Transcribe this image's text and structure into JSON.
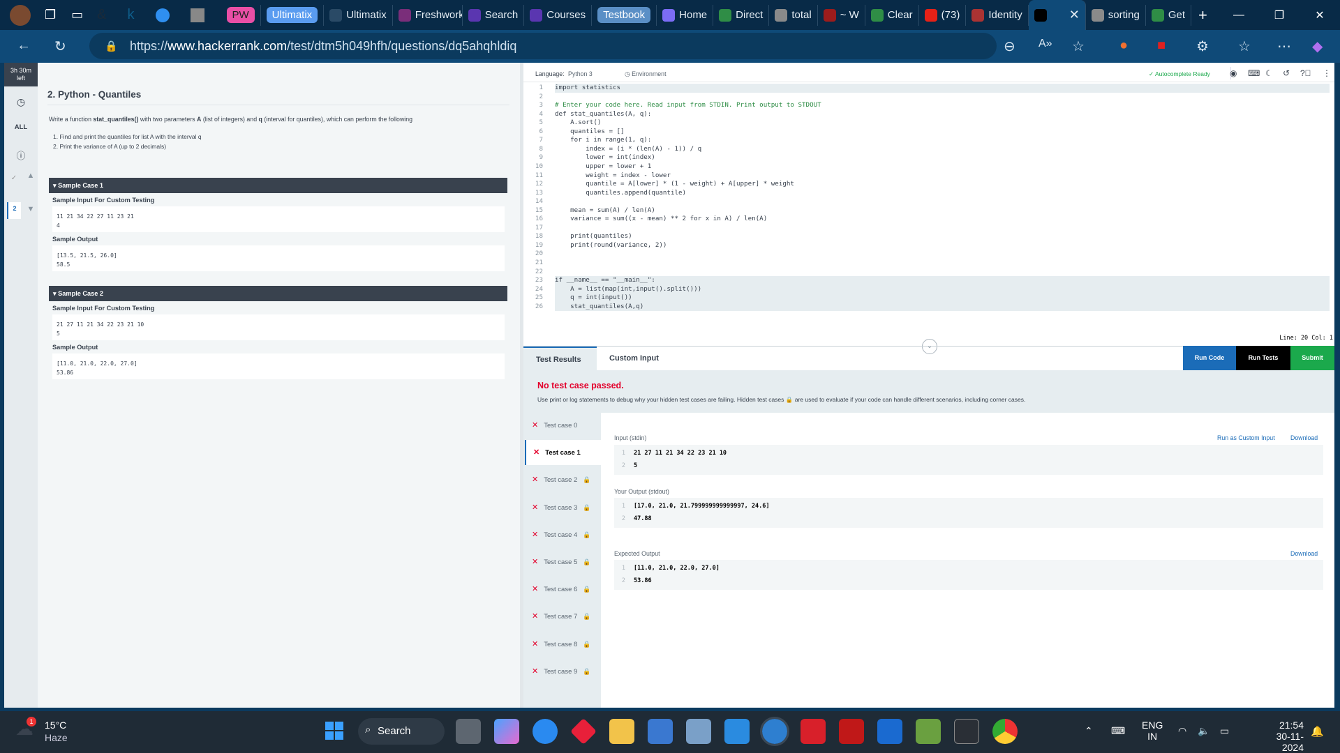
{
  "browser": {
    "tabs": [
      {
        "label": "PW",
        "color": "#e94fa6",
        "style": "pill"
      },
      {
        "label": "Ultimatix",
        "color": "#5a9cf0",
        "style": "pill"
      },
      {
        "label": "Ultimatix",
        "color": "#2a4a66"
      },
      {
        "label": "Freshworks",
        "color": "#7a2e7a"
      },
      {
        "label": "Search",
        "color": "#5a36b0"
      },
      {
        "label": "Courses",
        "color": "#5a36b0"
      },
      {
        "label": "Testbook",
        "color": "#5a8fc6",
        "style": "pill"
      },
      {
        "label": "Home",
        "color": "#7b6cf5"
      },
      {
        "label": "Direct",
        "color": "#2f8d46"
      },
      {
        "label": "total",
        "color": "#8a8a8a"
      },
      {
        "label": "~ W",
        "color": "#9b1c1c"
      },
      {
        "label": "Clear",
        "color": "#2f8d46"
      },
      {
        "label": "(73)",
        "color": "#e62117"
      },
      {
        "label": "Identity",
        "color": "#a33"
      },
      {
        "label": "",
        "color": "#000",
        "active": true
      },
      {
        "label": "sorting",
        "color": "#8a8a8a"
      },
      {
        "label": "Get",
        "color": "#2f8d46"
      }
    ],
    "url_prefix": "https://",
    "url_host": "www.hackerrank.com",
    "url_path": "/test/dtm5h049hfh/questions/dq5ahqhldiq"
  },
  "rail": {
    "timer_line1": "3h 30m",
    "timer_line2": "left",
    "all_label": "ALL",
    "current_question": "2"
  },
  "question": {
    "title": "2. Python - Quantiles",
    "desc_pre": "Write a function ",
    "desc_fn": "stat_quantiles()",
    "desc_mid1": " with two parameters ",
    "desc_A": "A",
    "desc_mid2": " (list of integers) and ",
    "desc_q": "q",
    "desc_post": " (interval for quantiles), which can perform the following",
    "steps": [
      "1. Find and print the quantiles for list A with the interval q",
      "2. Print the variance of A (up to 2 decimals)"
    ],
    "samples": [
      {
        "title": "Sample Case 1",
        "input_label": "Sample Input For Custom Testing",
        "input": "11 21 34 22 27 11 23 21\n4",
        "output_label": "Sample Output",
        "output": "[13.5, 21.5, 26.0]\n58.5"
      },
      {
        "title": "Sample Case 2",
        "input_label": "Sample Input For Custom Testing",
        "input": "21 27 11 21 34 22 23 21 10\n5",
        "output_label": "Sample Output",
        "output": "[11.0, 21.0, 22.0, 27.0]\n53.86"
      }
    ]
  },
  "editor": {
    "language_label": "Language:",
    "language": "Python 3",
    "environment": "Environment",
    "autocomplete": "Autocomplete Ready",
    "status": "Line: 20 Col: 1",
    "code": [
      "import statistics",
      "",
      "# Enter your code here. Read input from STDIN. Print output to STDOUT",
      "def stat_quantiles(A, q):",
      "    A.sort()",
      "    quantiles = []",
      "    for i in range(1, q):",
      "        index = (i * (len(A) - 1)) / q",
      "        lower = int(index)",
      "        upper = lower + 1",
      "        weight = index - lower",
      "        quantile = A[lower] * (1 - weight) + A[upper] * weight",
      "        quantiles.append(quantile)",
      "",
      "    mean = sum(A) / len(A)",
      "    variance = sum((x - mean) ** 2 for x in A) / len(A)",
      "",
      "    print(quantiles)",
      "    print(round(variance, 2))",
      "",
      "",
      "",
      "if __name__ == \"__main__\":",
      "    A = list(map(int,input().split()))",
      "    q = int(input())",
      "    stat_quantiles(A,q)"
    ]
  },
  "results": {
    "tabs": [
      "Test Results",
      "Custom Input"
    ],
    "buttons": {
      "run_code": "Run Code",
      "run_tests": "Run Tests",
      "submit": "Submit"
    },
    "colors": {
      "run_code": "#1b6cb8",
      "run_tests": "#000000",
      "submit": "#1ba94c",
      "fail": "#e3002b"
    },
    "headline": "No test case passed.",
    "hint": "Use print or log statements to debug why your hidden test cases are failing. Hidden test cases 🔒 are used to evaluate if your code can handle different scenarios, including corner cases.",
    "testcases": [
      {
        "label": "Test case 0",
        "locked": false
      },
      {
        "label": "Test case 1",
        "locked": false,
        "selected": true
      },
      {
        "label": "Test case 2",
        "locked": true
      },
      {
        "label": "Test case 3",
        "locked": true
      },
      {
        "label": "Test case 4",
        "locked": true
      },
      {
        "label": "Test case 5",
        "locked": true
      },
      {
        "label": "Test case 6",
        "locked": true
      },
      {
        "label": "Test case 7",
        "locked": true
      },
      {
        "label": "Test case 8",
        "locked": true
      },
      {
        "label": "Test case 9",
        "locked": true
      }
    ],
    "input_label": "Input (stdin)",
    "run_custom": "Run as Custom Input",
    "download": "Download",
    "input_lines": [
      "21 27 11 21 34 22 23 21 10",
      "5"
    ],
    "output_label": "Your Output (stdout)",
    "output_lines": [
      "[17.0, 21.0, 21.799999999999997, 24.6]",
      "47.88"
    ],
    "expected_label": "Expected Output",
    "expected_lines": [
      "[11.0, 21.0, 22.0, 27.0]",
      "53.86"
    ]
  },
  "taskbar": {
    "temp": "15°C",
    "weather": "Haze",
    "weather_badge": "1",
    "search": "Search",
    "lang1": "ENG",
    "lang2": "IN",
    "time": "21:54",
    "date": "30-11-2024"
  }
}
